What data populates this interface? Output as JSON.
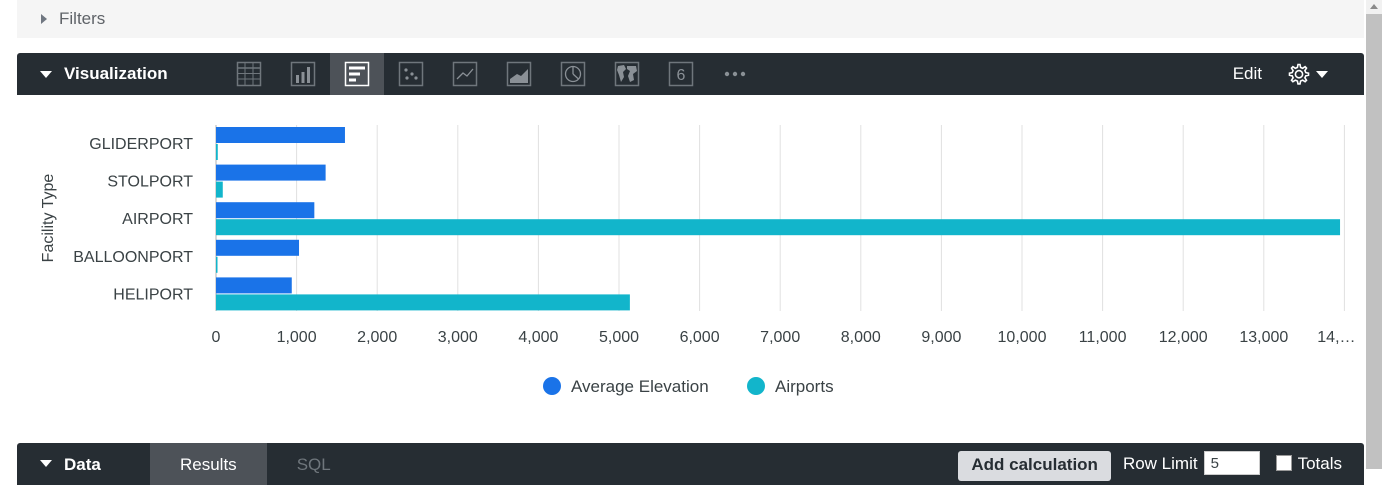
{
  "filters": {
    "label": "Filters"
  },
  "visualization": {
    "title": "Visualization",
    "types": [
      {
        "name": "table-chart-icon",
        "active": false
      },
      {
        "name": "column-chart-icon",
        "active": false
      },
      {
        "name": "bar-chart-icon",
        "active": true
      },
      {
        "name": "scatter-chart-icon",
        "active": false
      },
      {
        "name": "line-chart-icon",
        "active": false
      },
      {
        "name": "area-chart-icon",
        "active": false
      },
      {
        "name": "pie-chart-icon",
        "active": false
      },
      {
        "name": "map-chart-icon",
        "active": false
      },
      {
        "name": "single-value-icon",
        "active": false,
        "glyph": "6"
      },
      {
        "name": "more-options-icon",
        "active": false
      }
    ],
    "edit_label": "Edit"
  },
  "chart_data": {
    "type": "bar",
    "orientation": "horizontal",
    "categories": [
      "GLIDERPORT",
      "STOLPORT",
      "AIRPORT",
      "BALLOONPORT",
      "HELIPORT"
    ],
    "series": [
      {
        "name": "Average Elevation",
        "color": "#1a73e8",
        "values": [
          1600,
          1360,
          1220,
          1030,
          940
        ]
      },
      {
        "name": "Airports",
        "color": "#12b5cb",
        "values": [
          22,
          84,
          13946,
          1,
          5135
        ]
      }
    ],
    "ylabel": "Facility Type",
    "xlim": [
      0,
      14000
    ],
    "xticks": [
      "0",
      "1,000",
      "2,000",
      "3,000",
      "4,000",
      "5,000",
      "6,000",
      "7,000",
      "8,000",
      "9,000",
      "10,000",
      "11,000",
      "12,000",
      "13,000",
      "14,…"
    ],
    "grid": true,
    "legend_position": "bottom"
  },
  "data_panel": {
    "title": "Data",
    "tabs": [
      {
        "label": "Results",
        "active": true
      },
      {
        "label": "SQL",
        "active": false
      }
    ],
    "add_calculation_label": "Add calculation",
    "row_limit_label": "Row Limit",
    "row_limit_value": "5",
    "totals_label": "Totals"
  }
}
